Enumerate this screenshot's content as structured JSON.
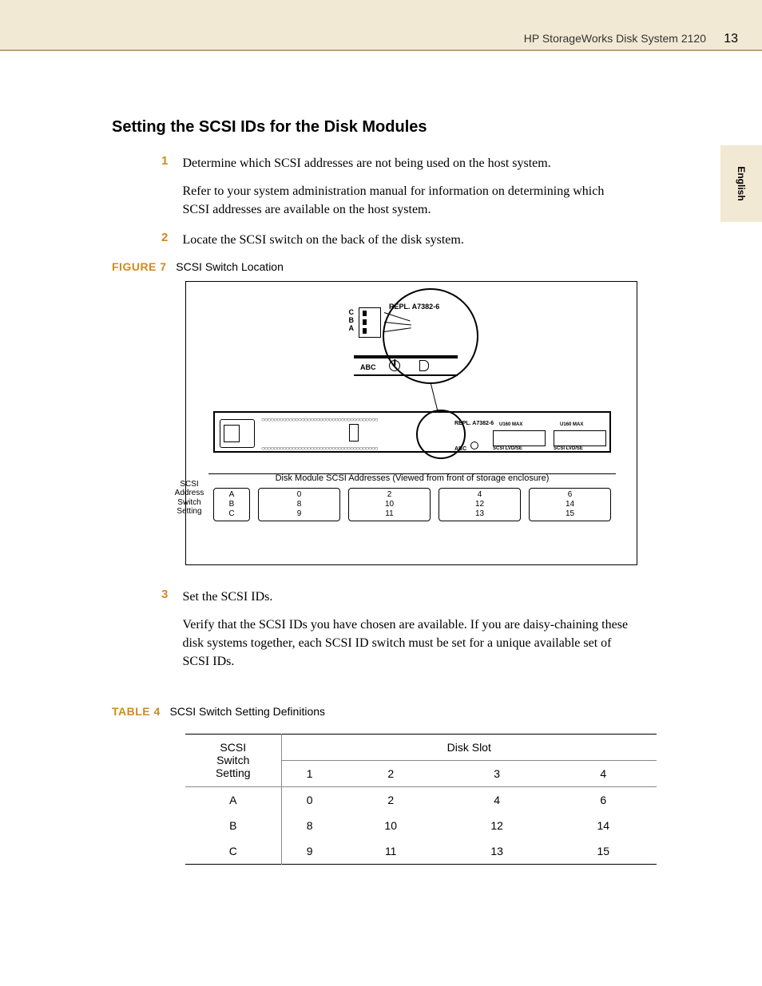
{
  "header": {
    "title": "HP  StorageWorks Disk System 2120",
    "page_number": "13"
  },
  "side_tab": {
    "label": "English"
  },
  "section": {
    "heading": "Setting the SCSI IDs for the Disk Modules"
  },
  "steps": {
    "s1": {
      "num": "1",
      "text": "Determine which SCSI addresses are not being used on the host system.",
      "sub": "Refer to your system administration manual for information on determining which SCSI addresses are available on the host system."
    },
    "s2": {
      "num": "2",
      "text": "Locate the SCSI switch on the back of the disk system."
    },
    "s3": {
      "num": "3",
      "text": "Set the SCSI IDs.",
      "sub": "Verify that the SCSI IDs you have chosen are available. If you are daisy-chaining these disk systems together, each SCSI ID switch must be set for a unique available set of SCSI IDs."
    }
  },
  "figure": {
    "tag": "FIGURE 7",
    "caption": "SCSI Switch Location",
    "zoom": {
      "repl": "REPL. A7382-6",
      "labels_cba": "C\nB\nA",
      "abc": "ABC"
    },
    "rack": {
      "repl": "REPL. A7382-6",
      "u160_1": "U160 MAX",
      "u160_2": "U160 MAX",
      "lvd1": "SCSI    LVD/SE",
      "lvd2": "SCSI    LVD/SE",
      "abc": "ABC"
    },
    "switch_label": "SCSI\nAddress\nSwitch\nSetting",
    "addr_caption": "Disk Module SCSI Addresses (Viewed from front of storage enclosure)",
    "switch_col": "A\nB\nC",
    "slots": [
      {
        "a": "0",
        "b": "8",
        "c": "9"
      },
      {
        "a": "2",
        "b": "10",
        "c": "11"
      },
      {
        "a": "4",
        "b": "12",
        "c": "13"
      },
      {
        "a": "6",
        "b": "14",
        "c": "15"
      }
    ]
  },
  "table": {
    "tag": "TABLE 4",
    "caption": "SCSI Switch Setting Definitions",
    "header": {
      "switch": "SCSI\nSwitch\nSetting",
      "diskslot": "Disk Slot",
      "cols": [
        "1",
        "2",
        "3",
        "4"
      ]
    },
    "rows": [
      {
        "setting": "A",
        "v": [
          "0",
          "2",
          "4",
          "6"
        ]
      },
      {
        "setting": "B",
        "v": [
          "8",
          "10",
          "12",
          "14"
        ]
      },
      {
        "setting": "C",
        "v": [
          "9",
          "11",
          "13",
          "15"
        ]
      }
    ]
  },
  "chart_data": {
    "type": "table",
    "title": "SCSI Switch Setting Definitions",
    "columns": [
      "SCSI Switch Setting",
      "Disk Slot 1",
      "Disk Slot 2",
      "Disk Slot 3",
      "Disk Slot 4"
    ],
    "rows": [
      [
        "A",
        0,
        2,
        4,
        6
      ],
      [
        "B",
        8,
        10,
        12,
        14
      ],
      [
        "C",
        9,
        11,
        13,
        15
      ]
    ]
  }
}
